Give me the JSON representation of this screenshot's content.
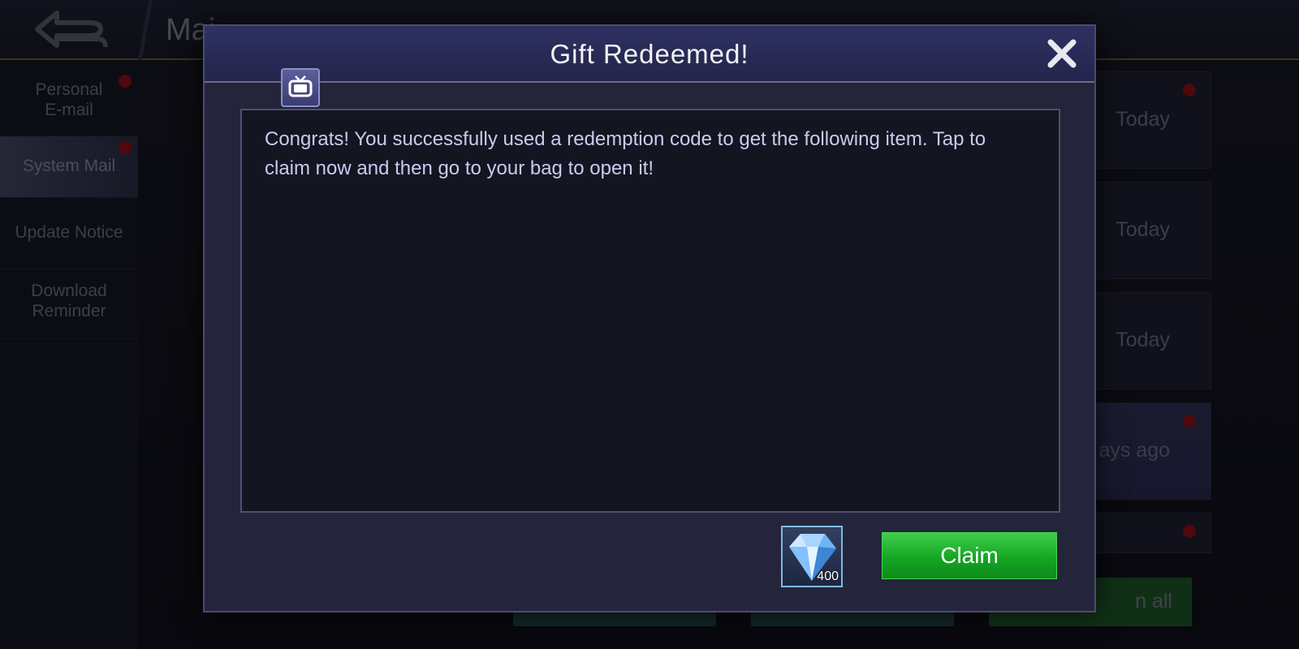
{
  "background": {
    "title": "Mai",
    "sidebar_items": [
      {
        "label_line1": "Personal",
        "label_line2": "E-mail"
      },
      {
        "label_line1": "System Mail",
        "label_line2": ""
      },
      {
        "label_line1": "Update Notice",
        "label_line2": ""
      },
      {
        "label_line1": "Download",
        "label_line2": "Reminder"
      }
    ],
    "mail_dates": [
      "Today",
      "Today",
      "Today",
      "ays ago"
    ],
    "claim_all_label": "n all"
  },
  "dialog": {
    "title": "Gift Redeemed!",
    "message": "Congrats! You successfully used a redemption code to get the following item. Tap to claim now and then go to your bag to open it!",
    "reward": {
      "icon": "diamond-icon",
      "quantity": "400"
    },
    "claim_label": "Claim"
  },
  "colors": {
    "accent_green": "#15a523",
    "title_bar": "#2f3162",
    "badge_red": "#7a0d14"
  }
}
